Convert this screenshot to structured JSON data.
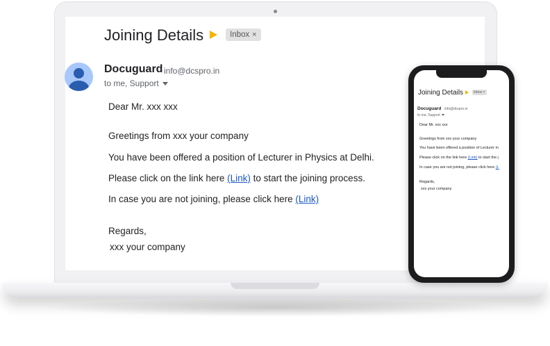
{
  "email": {
    "subject": "Joining Details",
    "label": "Inbox",
    "label_close": "×",
    "sender_name": "Docuguard",
    "sender_email": "info@dcspro.in",
    "recipients": "to me, Support",
    "greeting": "Dear Mr.  xxx xxx",
    "line1": "Greetings from xxx your company",
    "line2": "You have been offered a position of Lecturer in Physics at Delhi.",
    "line3_prefix": "Please click on the link here ",
    "line3_link": "(Link)",
    "line3_suffix": " to start the joining process.",
    "line4_prefix": "In case you are not joining, please click here ",
    "line4_link": "(Link)",
    "signoff": "Regards,",
    "signature": "xxx your company"
  },
  "phone_email": {
    "subject": "Joining Details",
    "label": "Inbox ×",
    "sender_name": "Docuguard",
    "sender_email": "info@dcspro.in",
    "recipients": "to me, Support",
    "greeting": "Dear Mr.  xxx xxx",
    "line1": "Greetings from xxx your company",
    "line2": "You have been offered a position of Lecturer in",
    "line3_prefix": "Please click on the link here ",
    "line3_link": "(Link)",
    "line3_suffix": " to start the j",
    "line4_prefix": "In case you are not joining, please click here ",
    "line4_link": "(L",
    "signoff": "Regards,",
    "signature": "xxx your company"
  },
  "colors": {
    "link": "#1a56c6",
    "important": "#f4b400",
    "avatar_bg": "#a8c7fa",
    "avatar_fg": "#2a5db0"
  },
  "icons": [
    "important-marker-icon",
    "close-icon",
    "avatar-person-icon",
    "caret-down-icon",
    "camera-icon"
  ]
}
